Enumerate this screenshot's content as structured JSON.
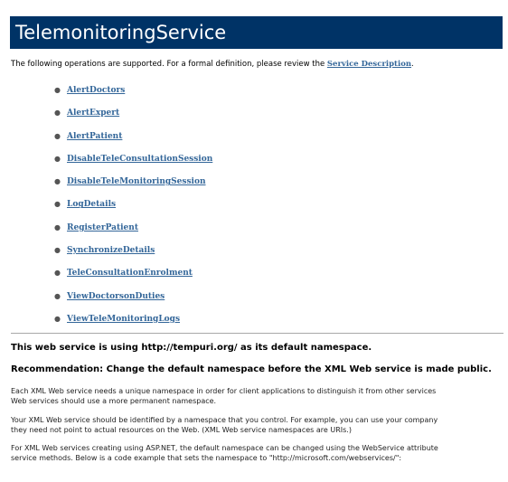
{
  "service": {
    "title": "TelemonitoringService"
  },
  "intro": {
    "text": "The following operations are supported. For a formal definition, please review the ",
    "link": "Service Description",
    "end": "."
  },
  "operations": [
    "AlertDoctors",
    "AlertExpert",
    "AlertPatient",
    "DisableTeleConsultationSession",
    "DisableTeleMonitoringSession",
    "LogDetails",
    "RegisterPatient",
    "SynchronizeDetails",
    "TeleConsultationEnrolment",
    "ViewDoctorsonDuties",
    "ViewTeleMonitoringLogs"
  ],
  "namespace_notice": "This web service is using http://tempuri.org/ as its default namespace.",
  "recommendation": "Recommendation: Change the default namespace before the XML Web service is made public.",
  "paragraphs": [
    {
      "line1": "Each XML Web service needs a unique namespace in order for client applications to distinguish it from other services",
      "line2": "Web services should use a more permanent namespace."
    },
    {
      "line1": "Your XML Web service should be identified by a namespace that you control. For example, you can use your company",
      "line2": "they need not point to actual resources on the Web. (XML Web service namespaces are URIs.)"
    },
    {
      "line1": "For XML Web services creating using ASP.NET, the default namespace can be changed using the WebService attribute",
      "line2": "service methods. Below is a code example that sets the namespace to \"http://microsoft.com/webservices/\":"
    }
  ]
}
